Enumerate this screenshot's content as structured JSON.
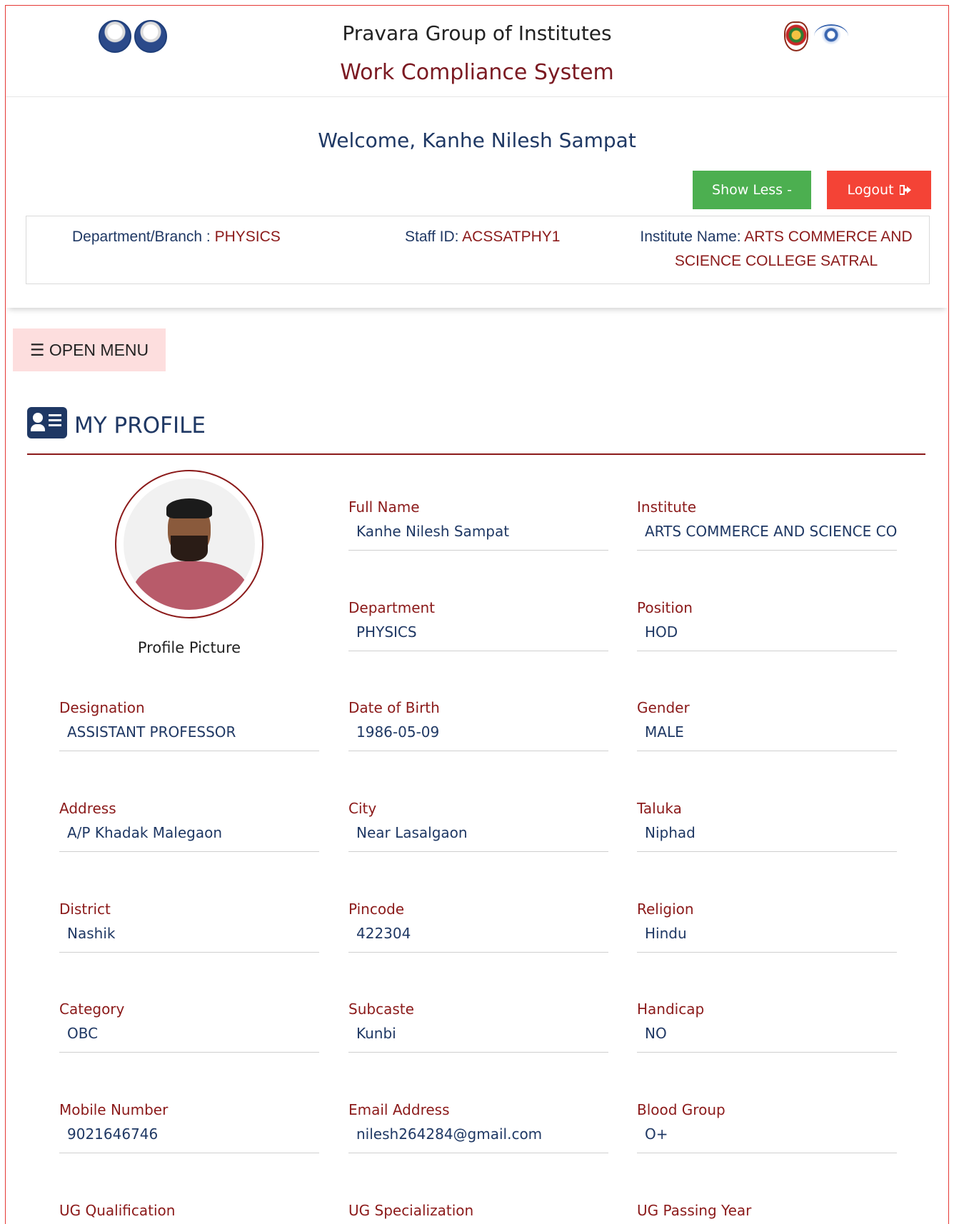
{
  "header": {
    "org_title": "Pravara Group of Institutes",
    "system_title": "Work Compliance System"
  },
  "welcome": {
    "greeting": "Welcome, Kanhe Nilesh Sampat",
    "show_less_label": "Show Less -",
    "logout_label": "Logout",
    "logout_icon": "sign-out-icon"
  },
  "info": {
    "dept_label": "Department/Branch : ",
    "dept_value": "PHYSICS",
    "staff_label": "Staff ID: ",
    "staff_value": "ACSSATPHY1",
    "inst_label": "Institute Name: ",
    "inst_value": "ARTS COMMERCE AND SCIENCE COLLEGE SATRAL"
  },
  "menu": {
    "label": "☰ OPEN MENU"
  },
  "profile": {
    "title": "MY PROFILE",
    "picture_label": "Profile Picture",
    "fields": [
      {
        "label": "Full Name",
        "value": "Kanhe Nilesh Sampat"
      },
      {
        "label": "Institute",
        "value": "ARTS COMMERCE AND SCIENCE COLLEGE SATRAL"
      },
      {
        "label": "Department",
        "value": "PHYSICS"
      },
      {
        "label": "Position",
        "value": "HOD"
      },
      {
        "label": "Designation",
        "value": "ASSISTANT PROFESSOR"
      },
      {
        "label": "Date of Birth",
        "value": "1986-05-09"
      },
      {
        "label": "Gender",
        "value": "MALE"
      },
      {
        "label": "Address",
        "value": "A/P Khadak Malegaon"
      },
      {
        "label": "City",
        "value": "Near Lasalgaon"
      },
      {
        "label": "Taluka",
        "value": "Niphad"
      },
      {
        "label": "District",
        "value": "Nashik"
      },
      {
        "label": "Pincode",
        "value": "422304"
      },
      {
        "label": "Religion",
        "value": "Hindu"
      },
      {
        "label": "Category",
        "value": "OBC"
      },
      {
        "label": "Subcaste",
        "value": "Kunbi"
      },
      {
        "label": "Handicap",
        "value": "NO"
      },
      {
        "label": "Mobile Number",
        "value": "9021646746"
      },
      {
        "label": "Email Address",
        "value": "nilesh264284@gmail.com"
      },
      {
        "label": "Blood Group",
        "value": "O+"
      },
      {
        "label": "UG Qualification",
        "value": ""
      },
      {
        "label": "UG Specialization",
        "value": ""
      },
      {
        "label": "UG Passing Year",
        "value": ""
      }
    ]
  },
  "colors": {
    "accent_navy": "#1f3864",
    "accent_maroon": "#8b1a1a",
    "show_less_green": "#4caf50",
    "logout_red": "#f44336",
    "menu_pink": "#fddede"
  }
}
